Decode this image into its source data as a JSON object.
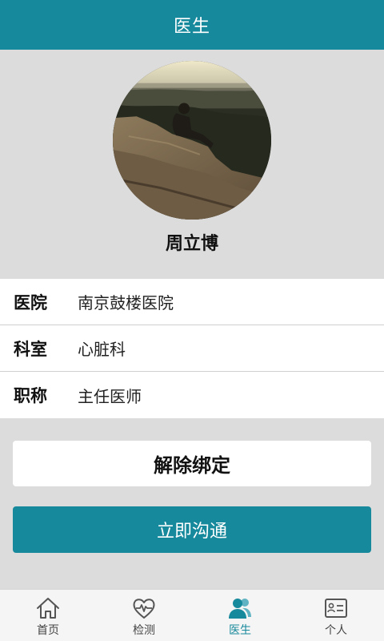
{
  "header": {
    "title": "医生"
  },
  "doctor": {
    "name": "周立博"
  },
  "info": [
    {
      "label": "医院",
      "value": "南京鼓楼医院"
    },
    {
      "label": "科室",
      "value": "心脏科"
    },
    {
      "label": "职称",
      "value": "主任医师"
    }
  ],
  "actions": {
    "unbind_label": "解除绑定",
    "chat_label": "立即沟通"
  },
  "tabbar": {
    "items": [
      {
        "label": "首页",
        "icon": "home-icon",
        "active": false
      },
      {
        "label": "检测",
        "icon": "heart-pulse-icon",
        "active": false
      },
      {
        "label": "医生",
        "icon": "doctor-icon",
        "active": true
      },
      {
        "label": "个人",
        "icon": "id-card-icon",
        "active": false
      }
    ]
  },
  "colors": {
    "accent": "#17899c",
    "background": "#dcdcdc",
    "tabbar_bg": "#f5f5f5"
  }
}
